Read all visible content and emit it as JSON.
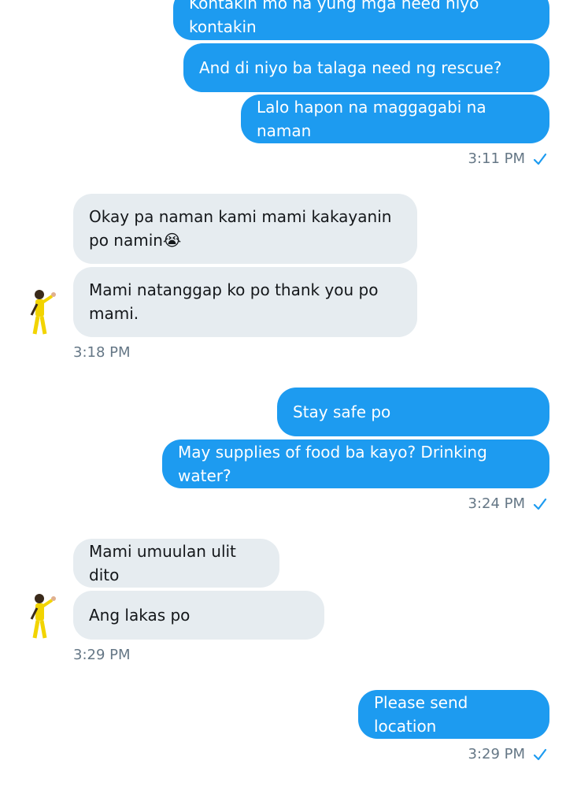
{
  "messages": {
    "s1": "Kontakin mo na yung mga need niyo kontakin",
    "s2": "And di niyo ba talaga need ng rescue?",
    "s3": "Lalo hapon na maggagabi na naman",
    "t1": "3:11 PM",
    "r1": "Okay pa naman kami mami kakayanin po namin😭",
    "r2": "Mami natanggap ko po thank you po mami.",
    "t2": "3:18 PM",
    "s4": "Stay safe po",
    "s5": "May supplies of food ba kayo? Drinking  water?",
    "t3": "3:24 PM",
    "r3": "Mami umuulan ulit dito",
    "r4": "Ang lakas po",
    "t4": "3:29 PM",
    "s6": "Please send location",
    "t5": "3:29 PM"
  },
  "icons": {
    "read": "checkmark-icon",
    "avatar": "avatar-yellow-jumpsuit"
  },
  "colors": {
    "sent_bubble": "#1d9bf0",
    "received_bubble": "#e6ecf0",
    "timestamp": "#657786"
  }
}
